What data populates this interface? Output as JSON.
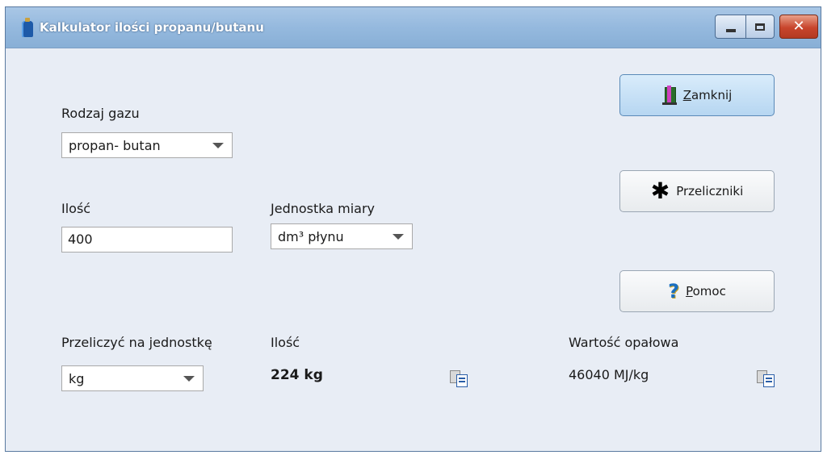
{
  "window": {
    "title": "Kalkulator ilości propanu/butanu",
    "close_symbol": "✕"
  },
  "gas_type": {
    "label": "Rodzaj gazu",
    "value": "propan- butan"
  },
  "quantity": {
    "label": "Ilość",
    "value": "400"
  },
  "unit": {
    "label": "Jednostka miary",
    "value": "dm³ płynu"
  },
  "convert_to": {
    "label": "Przeliczyć na jednostkę",
    "value": "kg"
  },
  "result": {
    "label": "Ilość",
    "value": "224 kg"
  },
  "heating_value": {
    "label": "Wartość opałowa",
    "value": "46040 MJ/kg"
  },
  "buttons": {
    "close": {
      "accel": "Z",
      "rest": "amknij",
      "icon": "exit-door-icon"
    },
    "converters": {
      "label": "Przeliczniki",
      "icon_glyph": "✱",
      "icon": "asterisk-icon"
    },
    "help": {
      "accel": "P",
      "rest": "omoc",
      "icon_glyph": "?",
      "icon": "help-icon"
    }
  }
}
